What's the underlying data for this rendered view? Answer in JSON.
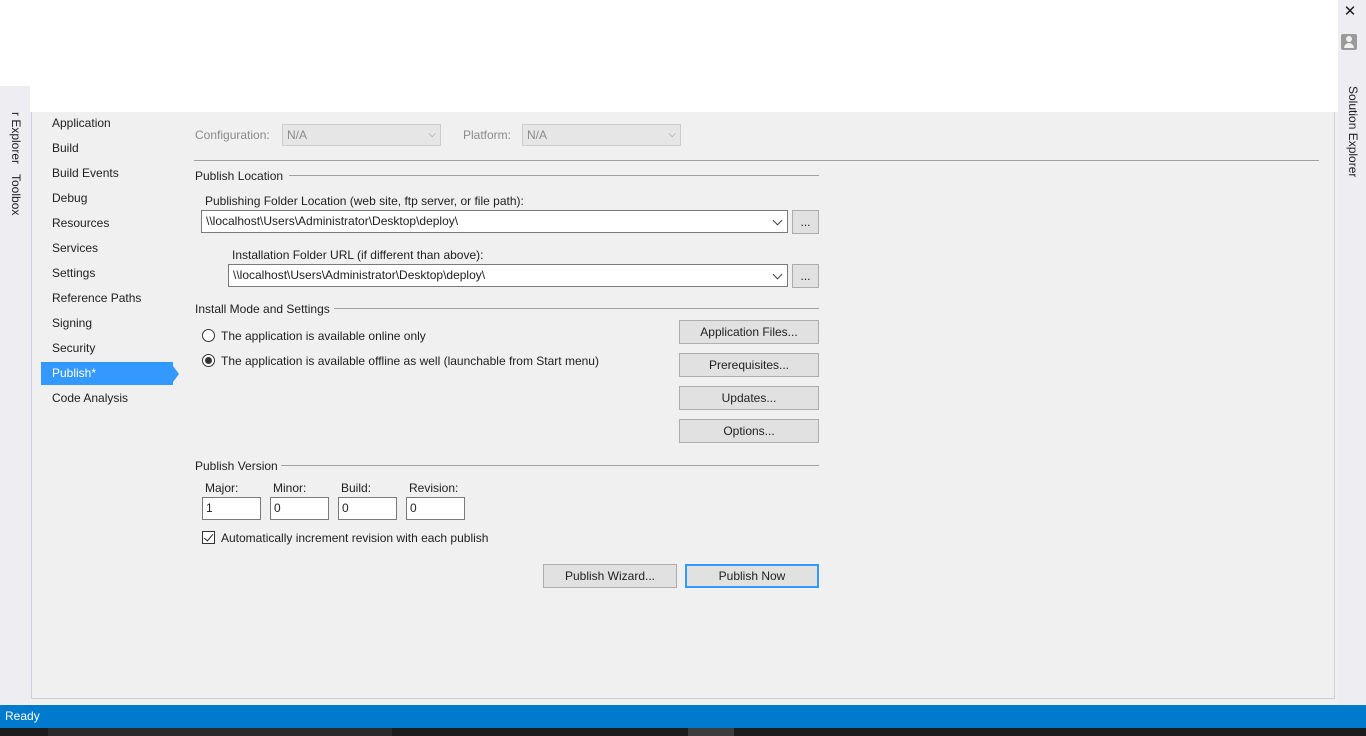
{
  "window": {
    "close_glyph": "✕",
    "right_tab": "Solution Explorer",
    "left_tabs": [
      "r Explorer",
      "Toolbox"
    ]
  },
  "nav": {
    "items": [
      {
        "label": "Application",
        "active": false
      },
      {
        "label": "Build",
        "active": false
      },
      {
        "label": "Build Events",
        "active": false
      },
      {
        "label": "Debug",
        "active": false
      },
      {
        "label": "Resources",
        "active": false
      },
      {
        "label": "Services",
        "active": false
      },
      {
        "label": "Settings",
        "active": false
      },
      {
        "label": "Reference Paths",
        "active": false
      },
      {
        "label": "Signing",
        "active": false
      },
      {
        "label": "Security",
        "active": false
      },
      {
        "label": "Publish*",
        "active": true
      },
      {
        "label": "Code Analysis",
        "active": false
      }
    ]
  },
  "config": {
    "configuration_label": "Configuration:",
    "configuration_value": "N/A",
    "platform_label": "Platform:",
    "platform_value": "N/A"
  },
  "publish_location": {
    "title": "Publish Location",
    "folder_label": "Publishing Folder Location (web site, ftp server, or file path):",
    "folder_value": "\\\\localhost\\Users\\Administrator\\Desktop\\deploy\\",
    "install_label": "Installation Folder URL (if different than above):",
    "install_value": "\\\\localhost\\Users\\Administrator\\Desktop\\deploy\\",
    "browse_label": "..."
  },
  "install_mode": {
    "title": "Install Mode and Settings",
    "online_label": "The application is available online only",
    "offline_label": "The application is available offline as well (launchable from Start menu)",
    "app_files_label": "Application Files...",
    "prereq_label": "Prerequisites...",
    "updates_label": "Updates...",
    "options_label": "Options..."
  },
  "publish_version": {
    "title": "Publish Version",
    "major_label": "Major:",
    "minor_label": "Minor:",
    "build_label": "Build:",
    "revision_label": "Revision:",
    "major": "1",
    "minor": "0",
    "build": "0",
    "revision": "0",
    "auto_increment_label": "Automatically increment revision with each publish"
  },
  "actions": {
    "wizard_label": "Publish Wizard...",
    "now_label": "Publish Now"
  },
  "status": {
    "text": "Ready"
  },
  "colors": {
    "accent": "#3399ff",
    "status_bar": "#007acc"
  }
}
